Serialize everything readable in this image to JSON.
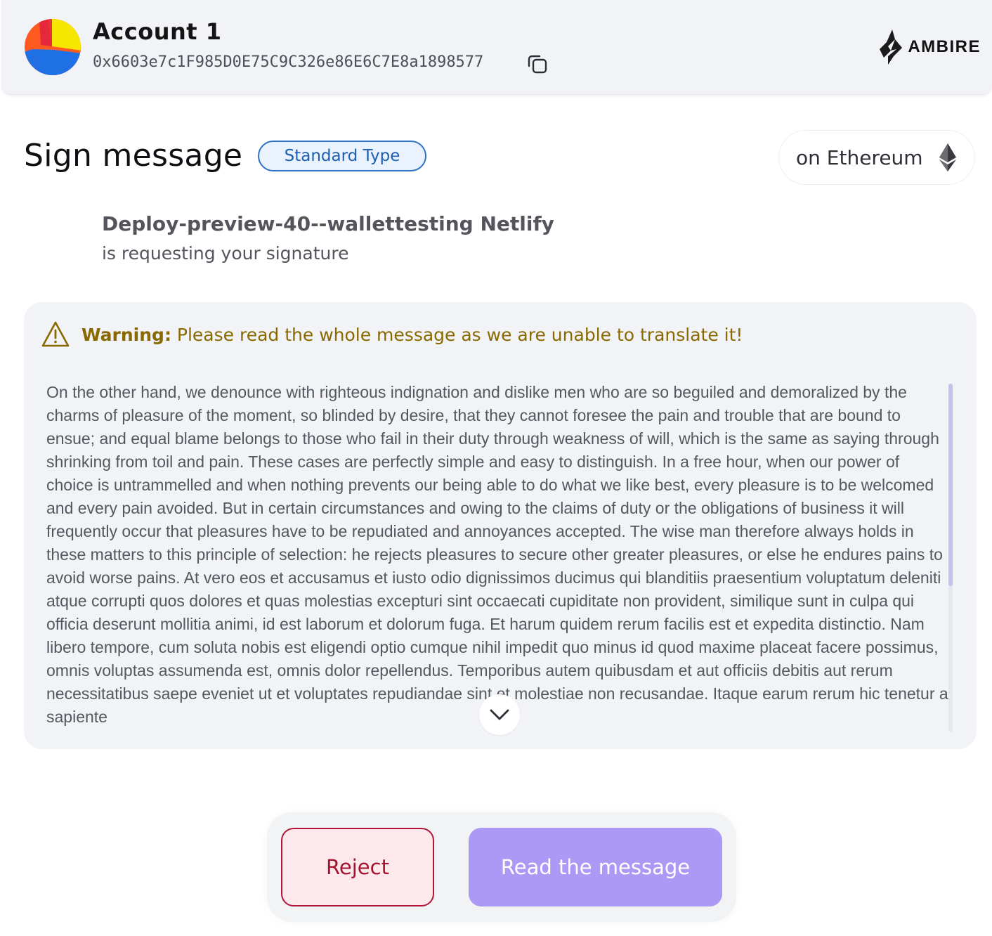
{
  "header": {
    "account_name": "Account 1",
    "account_address": "0x6603e7c1F985D0E75C9C326e86E6C7E8a1898577",
    "brand_name": "AMBIRE",
    "avatar_colors": [
      "#1f6fe5",
      "#f7e600",
      "#ff5a1f",
      "#e4223f"
    ]
  },
  "page": {
    "title": "Sign message",
    "type_badge": "Standard Type",
    "network_label": "on Ethereum"
  },
  "dapp": {
    "name": "Deploy-preview-40--wallettesting Netlify",
    "subtitle": "is requesting your signature"
  },
  "warning": {
    "label": "Warning:",
    "text": "Please read the whole message as we are unable to translate it!",
    "color": "#8a6a00"
  },
  "message": {
    "body": "On the other hand, we denounce with righteous indignation and dislike men who are so beguiled and demoralized by the charms of pleasure of the moment, so blinded by desire, that they cannot foresee the pain and trouble that are bound to ensue; and equal blame belongs to those who fail in their duty through weakness of will, which is the same as saying through shrinking from toil and pain. These cases are perfectly simple and easy to distinguish. In a free hour, when our power of choice is untrammelled and when nothing prevents our being able to do what we like best, every pleasure is to be welcomed and every pain avoided. But in certain circumstances and owing to the claims of duty or the obligations of business it will frequently occur that pleasures have to be repudiated and annoyances accepted. The wise man therefore always holds in these matters to this principle of selection: he rejects pleasures to secure other greater pleasures, or else he endures pains to avoid worse pains. At vero eos et accusamus et iusto odio dignissimos ducimus qui blanditiis praesentium voluptatum deleniti atque corrupti quos dolores et quas molestias excepturi sint occaecati cupiditate non provident, similique sunt in culpa qui officia deserunt mollitia animi, id est laborum et dolorum fuga. Et harum quidem rerum facilis est et expedita distinctio. Nam libero tempore, cum soluta nobis est eligendi optio cumque nihil impedit quo minus id quod maxime placeat facere possimus, omnis voluptas assumenda est, omnis dolor repellendus. Temporibus autem quibusdam et aut officiis debitis aut rerum necessitatibus saepe eveniet ut et voluptates repudiandae sint et molestiae non recusandae. Itaque earum rerum hic tenetur a sapiente"
  },
  "actions": {
    "reject_label": "Reject",
    "read_label": "Read the message",
    "reject_color": "#b3153a",
    "read_color": "#ac98f5"
  },
  "icons": {
    "copy": "copy-icon",
    "brand": "ambire-logo-icon",
    "network": "ethereum-icon",
    "warning": "warning-triangle-icon",
    "scroll": "chevron-down-icon"
  }
}
